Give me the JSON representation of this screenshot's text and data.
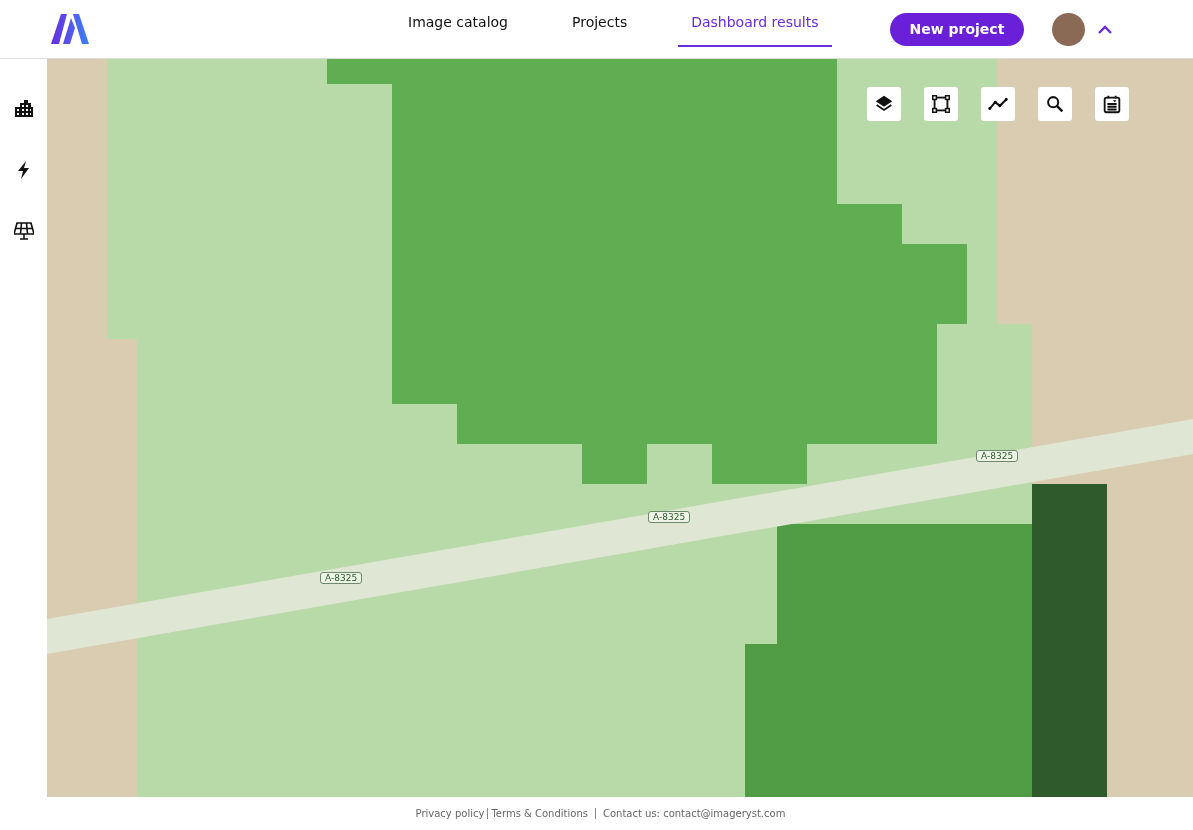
{
  "nav": {
    "tabs": [
      {
        "label": "Image catalog",
        "selected": false
      },
      {
        "label": "Projects",
        "selected": false
      },
      {
        "label": "Dashboard results",
        "selected": true
      }
    ],
    "new_project_button": "New project",
    "user_menu": {
      "expanded": true
    }
  },
  "sidebar": {
    "items": [
      {
        "kind": "buildings"
      },
      {
        "kind": "energy"
      },
      {
        "kind": "solar"
      }
    ]
  },
  "map": {
    "toolbar": [
      {
        "kind": "layers"
      },
      {
        "kind": "polygon"
      },
      {
        "kind": "chart"
      },
      {
        "kind": "search"
      },
      {
        "kind": "calendar"
      }
    ],
    "road_labels": [
      "A-8325",
      "A-8325",
      "A-8325"
    ]
  },
  "footer": {
    "links": [
      "Privacy policy",
      "Terms & Conditions",
      "Contact us: contact@imageryst.com"
    ]
  }
}
